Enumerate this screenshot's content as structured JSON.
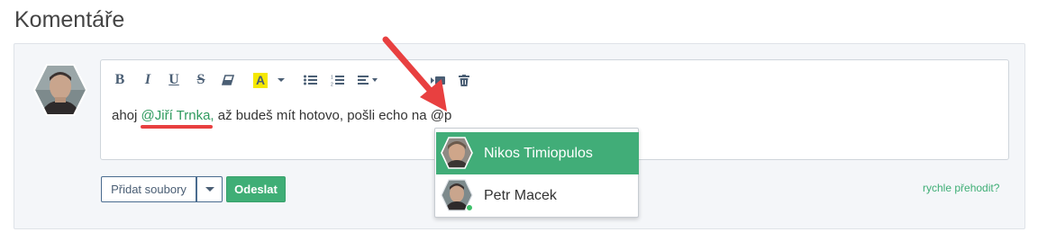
{
  "section": {
    "title": "Komentáře"
  },
  "editor": {
    "toolbar": {
      "bold": "B",
      "italic": "I",
      "underline": "U",
      "strike": "S",
      "highlight": "A"
    },
    "content": {
      "prefix": "ahoj ",
      "mention": "@Jiří Trnka,",
      "suffix": " až budeš mít hotovo, pošli echo na @p"
    }
  },
  "actions": {
    "add_files_label": "Přidat soubory",
    "send_label": "Odeslat",
    "quick_switch_label": "rychle přehodit?"
  },
  "mention_suggestions": {
    "items": [
      {
        "name": "Nikos Timiopulos",
        "selected": true
      },
      {
        "name": "Petr Macek",
        "selected": false,
        "online": true
      }
    ]
  },
  "colors": {
    "accent_green": "#41ad78",
    "mention_green": "#2e9a5e",
    "annotation_red": "#e84040",
    "highlight_yellow": "#f5e800"
  }
}
